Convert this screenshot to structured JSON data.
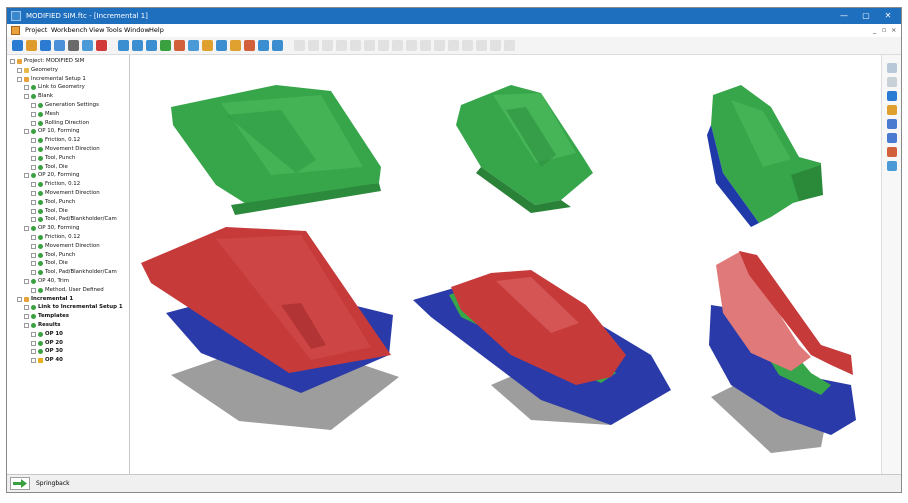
{
  "window": {
    "title": "MODIFIED SIM.ftc - [Incremental 1]"
  },
  "window_controls": {
    "minimize": "—",
    "maximize": "▢",
    "close": "✕",
    "child_minimize": "_",
    "child_restore": "▫",
    "child_close": "×"
  },
  "menu": [
    "Project",
    "Workbench",
    "View",
    "Tools",
    "Window",
    "Help"
  ],
  "tree": [
    {
      "label": "Project: MODIFIED SIM",
      "depth": 0,
      "icon": "project-icon",
      "bold": false
    },
    {
      "label": "Geometry",
      "depth": 1,
      "icon": "folder-icon",
      "bold": false
    },
    {
      "label": "Incremental Setup 1",
      "depth": 1,
      "icon": "setup-icon",
      "bold": false
    },
    {
      "label": "Link to Geometry",
      "depth": 2,
      "icon": "status-dot-icon",
      "bold": false
    },
    {
      "label": "Blank",
      "depth": 2,
      "icon": "status-dot-icon",
      "bold": false
    },
    {
      "label": "Generation Settings",
      "depth": 3,
      "icon": "status-dot-icon",
      "bold": false
    },
    {
      "label": "Mesh",
      "depth": 3,
      "icon": "status-dot-icon",
      "bold": false
    },
    {
      "label": "Rolling Direction",
      "depth": 3,
      "icon": "status-dot-icon",
      "bold": false
    },
    {
      "label": "OP 10, Forming",
      "depth": 2,
      "icon": "status-dot-icon",
      "bold": false
    },
    {
      "label": "Friction, 0.12",
      "depth": 3,
      "icon": "status-dot-icon",
      "bold": false
    },
    {
      "label": "Movement Direction",
      "depth": 3,
      "icon": "status-dot-icon",
      "bold": false
    },
    {
      "label": "Tool, Punch",
      "depth": 3,
      "icon": "status-dot-icon",
      "bold": false
    },
    {
      "label": "Tool, Die",
      "depth": 3,
      "icon": "status-dot-icon",
      "bold": false
    },
    {
      "label": "OP 20, Forming",
      "depth": 2,
      "icon": "status-dot-icon",
      "bold": false
    },
    {
      "label": "Friction, 0.12",
      "depth": 3,
      "icon": "status-dot-icon",
      "bold": false
    },
    {
      "label": "Movement Direction",
      "depth": 3,
      "icon": "status-dot-icon",
      "bold": false
    },
    {
      "label": "Tool, Punch",
      "depth": 3,
      "icon": "status-dot-icon",
      "bold": false
    },
    {
      "label": "Tool, Die",
      "depth": 3,
      "icon": "status-dot-icon",
      "bold": false
    },
    {
      "label": "Tool, Pad/Blankholder/Cam",
      "depth": 3,
      "icon": "status-dot-icon",
      "bold": false
    },
    {
      "label": "OP 30, Forming",
      "depth": 2,
      "icon": "status-dot-icon",
      "bold": false
    },
    {
      "label": "Friction, 0.12",
      "depth": 3,
      "icon": "status-dot-icon",
      "bold": false
    },
    {
      "label": "Movement Direction",
      "depth": 3,
      "icon": "status-dot-icon",
      "bold": false
    },
    {
      "label": "Tool, Punch",
      "depth": 3,
      "icon": "status-dot-icon",
      "bold": false
    },
    {
      "label": "Tool, Die",
      "depth": 3,
      "icon": "status-dot-icon",
      "bold": false
    },
    {
      "label": "Tool, Pad/Blankholder/Cam",
      "depth": 3,
      "icon": "status-dot-icon",
      "bold": false
    },
    {
      "label": "OP 40, Trim",
      "depth": 2,
      "icon": "status-dot-icon",
      "bold": false
    },
    {
      "label": "Method, User Defined",
      "depth": 3,
      "icon": "status-dot-icon",
      "bold": false
    },
    {
      "label": "Incremental 1",
      "depth": 1,
      "icon": "incremental-icon",
      "bold": true
    },
    {
      "label": "Link to Incremental Setup 1",
      "depth": 2,
      "icon": "status-dot-icon",
      "bold": true
    },
    {
      "label": "Templates",
      "depth": 2,
      "icon": "status-dot-icon",
      "bold": true
    },
    {
      "label": "Results",
      "depth": 2,
      "icon": "status-dot-icon",
      "bold": true
    },
    {
      "label": "OP 10",
      "depth": 3,
      "icon": "status-dot-icon",
      "bold": true
    },
    {
      "label": "OP 20",
      "depth": 3,
      "icon": "status-dot-icon",
      "bold": true
    },
    {
      "label": "OP 30",
      "depth": 3,
      "icon": "status-dot-icon",
      "bold": true
    },
    {
      "label": "OP 40",
      "depth": 3,
      "icon": "warning-icon",
      "bold": true
    }
  ],
  "toolbar_icons": [
    "new-icon",
    "open-icon",
    "save-icon",
    "camera-icon",
    "settings-icon",
    "report-icon",
    "help-icon",
    "fit-view-icon",
    "zoom-icon",
    "zoom-box-icon",
    "rotate-icon",
    "pan-icon",
    "cut-plane-icon",
    "layers-icon",
    "cylinder-icon",
    "measure-icon",
    "ruler-icon",
    "search-icon",
    "filter-icon",
    "disabled-tool-icon",
    "disabled-tool-icon",
    "disabled-tool-icon",
    "disabled-tool-icon",
    "disabled-tool-icon",
    "disabled-tool-icon",
    "disabled-tool-icon",
    "disabled-tool-icon",
    "disabled-tool-icon",
    "disabled-tool-icon",
    "disabled-tool-icon",
    "disabled-tool-icon",
    "disabled-tool-icon",
    "disabled-tool-icon",
    "disabled-tool-icon",
    "disabled-tool-icon"
  ],
  "right_icons": [
    "gear-icon",
    "sigma-icon",
    "save-icon",
    "gauge-icon",
    "axes-icon",
    "axes-alt-icon",
    "compare-icon",
    "export-icon"
  ],
  "colors": {
    "title_bar": "#1f6fbf",
    "part_green": "#37a64a",
    "tool_red": "#c63a3a",
    "tool_blue": "#2a3aa8",
    "shadow": "#8a8a8a"
  },
  "status": {
    "label": "Springback",
    "icon": "arrow-right-icon"
  }
}
